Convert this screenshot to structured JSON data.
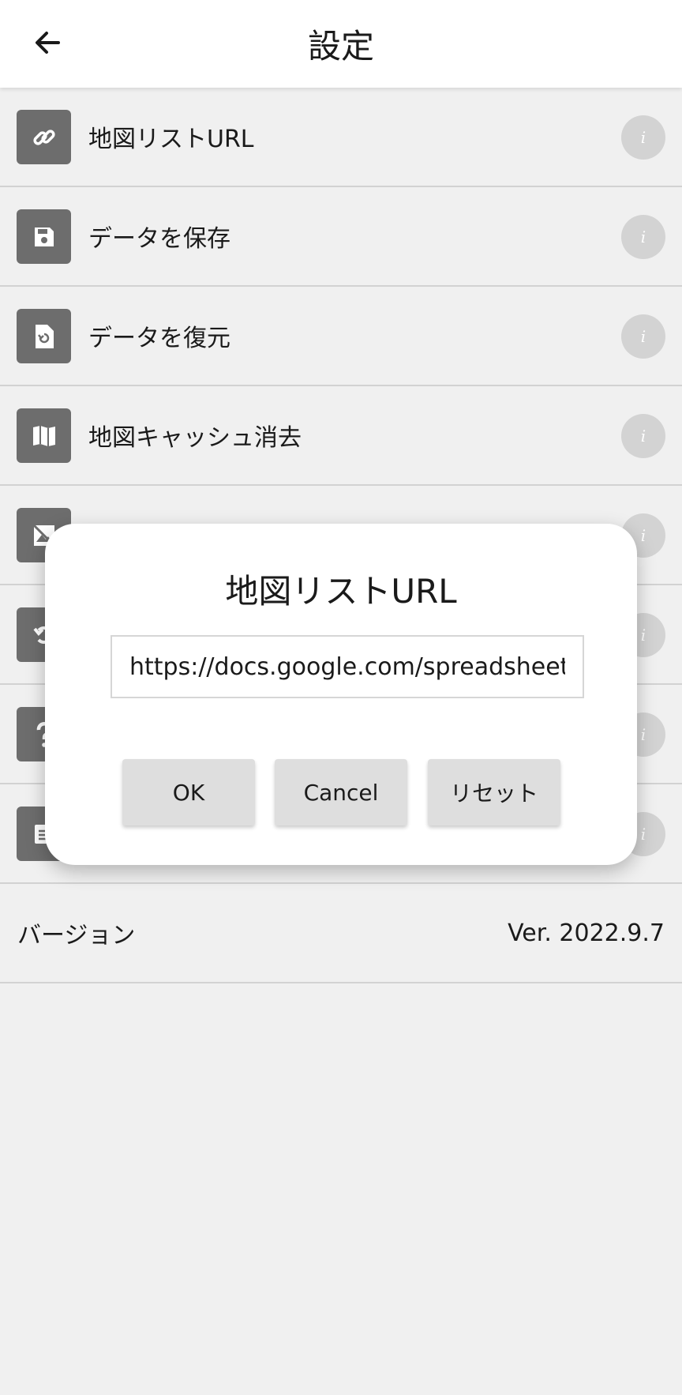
{
  "header": {
    "title": "設定",
    "back_icon": "arrow-left-icon"
  },
  "settings": {
    "items": [
      {
        "label": "地図リストURL",
        "icon": "link-icon",
        "info": "i"
      },
      {
        "label": "データを保存",
        "icon": "floppy-disk-icon",
        "info": "i"
      },
      {
        "label": "データを復元",
        "icon": "file-restore-icon",
        "info": "i"
      },
      {
        "label": "地図キャッシュ消去",
        "icon": "map-icon",
        "info": "i"
      },
      {
        "label": "",
        "icon": "image-off-icon",
        "info": "i"
      },
      {
        "label": "",
        "icon": "reset-icon",
        "info": "i"
      },
      {
        "label": "",
        "icon": "help-icon",
        "info": "i"
      },
      {
        "label": "",
        "icon": "document-icon",
        "info": "i"
      }
    ]
  },
  "version": {
    "label": "バージョン",
    "value": "Ver. 2022.9.7"
  },
  "dialog": {
    "title": "地図リストURL",
    "url_value": "https://docs.google.com/spreadsheets/",
    "ok_label": "OK",
    "cancel_label": "Cancel",
    "reset_label": "リセット"
  },
  "colors": {
    "icon_bg": "#6d6d6d",
    "info_bg": "#d3d3d3",
    "page_bg": "#f0f0f0",
    "button_bg": "#dedede"
  }
}
